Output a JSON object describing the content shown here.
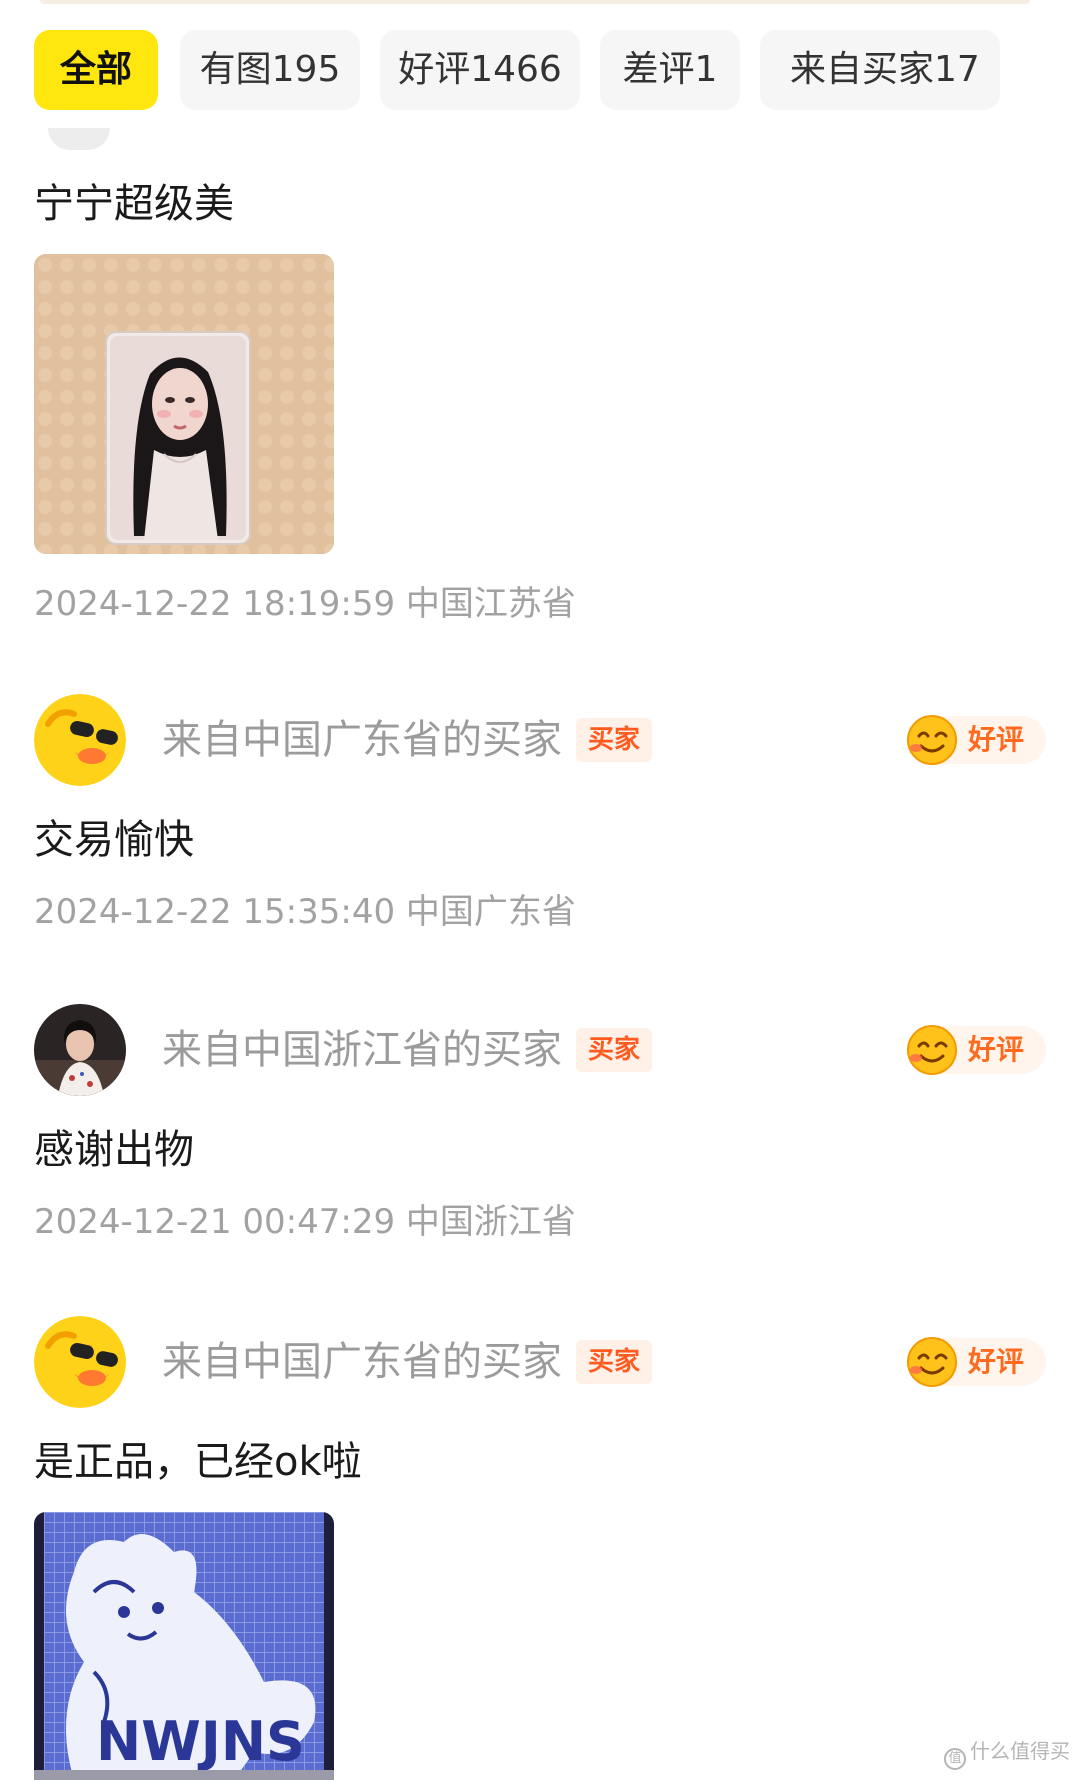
{
  "filters": {
    "tabs": [
      {
        "label": "全部",
        "active": true
      },
      {
        "label": "有图195",
        "active": false
      },
      {
        "label": "好评1466",
        "active": false
      },
      {
        "label": "差评1",
        "active": false
      },
      {
        "label": "来自买家17",
        "active": false
      }
    ]
  },
  "reviews": [
    {
      "content": "宁宁超级美",
      "has_photo": true,
      "meta": "2024-12-22 18:19:59 中国江苏省"
    },
    {
      "user": "来自中国广东省的买家",
      "badge": "买家",
      "rating": "好评",
      "content": "交易愉快",
      "meta": "2024-12-22 15:35:40 中国广东省"
    },
    {
      "user": "来自中国浙江省的买家",
      "badge": "买家",
      "rating": "好评",
      "content": "感谢出物",
      "meta": "2024-12-21 00:47:29 中国浙江省"
    },
    {
      "user": "来自中国广东省的买家",
      "badge": "买家",
      "rating": "好评",
      "content": "是正品，已经ok啦",
      "has_photo": true,
      "photo_text": "NWJNS"
    }
  ],
  "watermark": "什么值得买",
  "colors": {
    "accent_yellow": "#ffe60f",
    "rating_orange": "#ff6a1f",
    "badge_bg": "#fff1e8"
  }
}
